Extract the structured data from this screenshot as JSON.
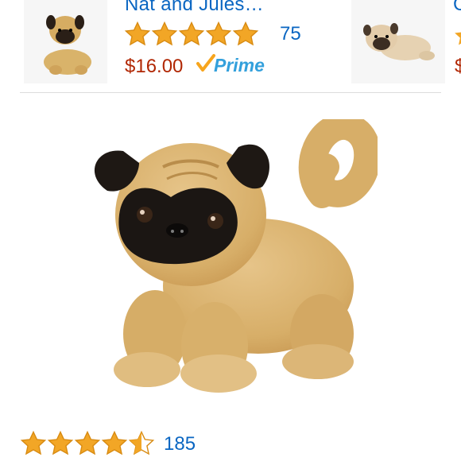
{
  "top_product": {
    "title": "Nat and Jules…",
    "rating_count": "75",
    "price": "$16.00",
    "prime_label": "Prime",
    "rating_stars": 5
  },
  "right_product": {
    "title_fragment": "C",
    "price_fragment": "$"
  },
  "main_product": {
    "rating_count": "185",
    "rating_stars": 4.5
  },
  "colors": {
    "link": "#0a66c2",
    "price": "#b12704",
    "star": "#f2a626",
    "prime": "#33a0dc"
  }
}
